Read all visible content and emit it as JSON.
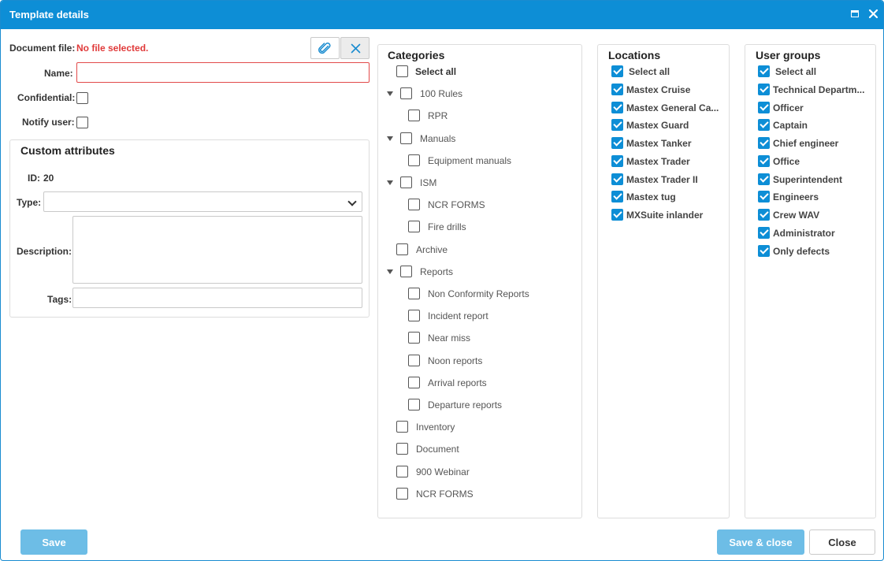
{
  "dialog": {
    "title": "Template details"
  },
  "form": {
    "document_file_label": "Document file:",
    "document_file_value": "No file selected.",
    "name_label": "Name:",
    "name_value": "",
    "confidential_label": "Confidential:",
    "confidential_checked": false,
    "notify_label": "Notify user:",
    "notify_checked": false
  },
  "custom_attributes": {
    "title": "Custom attributes",
    "id_label": "ID:",
    "id_value": "20",
    "type_label": "Type:",
    "type_value": "",
    "description_label": "Description:",
    "description_value": "",
    "tags_label": "Tags:",
    "tags_value": ""
  },
  "categories": {
    "title": "Categories",
    "select_all": "Select all",
    "items": [
      {
        "label": "100 Rules",
        "level": 0,
        "expandable": true,
        "checked": false
      },
      {
        "label": "RPR",
        "level": 1,
        "expandable": false,
        "checked": false
      },
      {
        "label": "Manuals",
        "level": 0,
        "expandable": true,
        "checked": false
      },
      {
        "label": "Equipment manuals",
        "level": 1,
        "expandable": false,
        "checked": false
      },
      {
        "label": "ISM",
        "level": 0,
        "expandable": true,
        "checked": false
      },
      {
        "label": "NCR FORMS",
        "level": 1,
        "expandable": false,
        "checked": false
      },
      {
        "label": "Fire drills",
        "level": 1,
        "expandable": false,
        "checked": false
      },
      {
        "label": "Archive",
        "level": 0,
        "expandable": false,
        "checked": false
      },
      {
        "label": "Reports",
        "level": 0,
        "expandable": true,
        "checked": false
      },
      {
        "label": "Non Conformity Reports",
        "level": 1,
        "expandable": false,
        "checked": false
      },
      {
        "label": "Incident report",
        "level": 1,
        "expandable": false,
        "checked": false
      },
      {
        "label": "Near miss",
        "level": 1,
        "expandable": false,
        "checked": false
      },
      {
        "label": "Noon reports",
        "level": 1,
        "expandable": false,
        "checked": false
      },
      {
        "label": "Arrival reports",
        "level": 1,
        "expandable": false,
        "checked": false
      },
      {
        "label": "Departure reports",
        "level": 1,
        "expandable": false,
        "checked": false
      },
      {
        "label": "Inventory",
        "level": 0,
        "expandable": false,
        "checked": false
      },
      {
        "label": "Document",
        "level": 0,
        "expandable": false,
        "checked": false
      },
      {
        "label": "900 Webinar",
        "level": 0,
        "expandable": false,
        "checked": false
      },
      {
        "label": "NCR FORMS",
        "level": 0,
        "expandable": false,
        "checked": false
      }
    ]
  },
  "locations": {
    "title": "Locations",
    "select_all": "Select all",
    "items": [
      {
        "label": "Mastex Cruise",
        "checked": true
      },
      {
        "label": "Mastex General Ca...",
        "checked": true
      },
      {
        "label": "Mastex Guard",
        "checked": true
      },
      {
        "label": "Mastex Tanker",
        "checked": true
      },
      {
        "label": "Mastex Trader",
        "checked": true
      },
      {
        "label": "Mastex Trader II",
        "checked": true
      },
      {
        "label": "Mastex tug",
        "checked": true
      },
      {
        "label": "MXSuite inlander",
        "checked": true
      }
    ]
  },
  "user_groups": {
    "title": "User groups",
    "select_all": "Select all",
    "items": [
      {
        "label": "Technical Departm...",
        "checked": true
      },
      {
        "label": "Officer",
        "checked": true
      },
      {
        "label": "Captain",
        "checked": true
      },
      {
        "label": "Chief engineer",
        "checked": true
      },
      {
        "label": "Office",
        "checked": true
      },
      {
        "label": "Superintendent",
        "checked": true
      },
      {
        "label": "Engineers",
        "checked": true
      },
      {
        "label": "Crew WAV",
        "checked": true
      },
      {
        "label": "Administrator",
        "checked": true
      },
      {
        "label": "Only defects",
        "checked": true
      }
    ]
  },
  "footer": {
    "save_label": "Save",
    "save_close_label": "Save & close",
    "close_label": "Close"
  },
  "icons": {
    "attach": "paperclip-icon",
    "clear": "close-icon",
    "maximize": "maximize-icon",
    "window_close": "close-icon",
    "type_dropdown": "chevron-down-icon"
  },
  "colors": {
    "accent": "#0d8ed6",
    "error": "#e03a3a",
    "primary_button": "#6dbde6"
  }
}
